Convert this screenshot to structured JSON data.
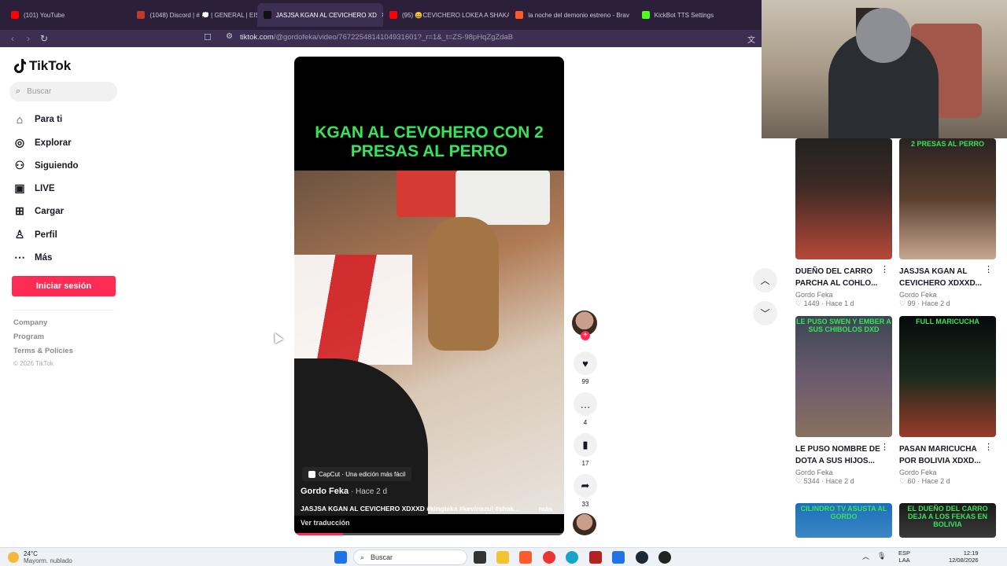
{
  "browser": {
    "tabs": [
      {
        "label": "(101) YouTube",
        "color": "#ff0000"
      },
      {
        "label": "(1048) Discord | # 💭 | GENERAL | EISUS",
        "color": "#c0392b"
      },
      {
        "label": "JASJSA KGAN AL CEVICHERO XD",
        "color": "#111111",
        "active": true
      },
      {
        "label": "(95) 😄CEVICHERO LOKEA A SHAKA",
        "color": "#ff0000"
      },
      {
        "label": "la noche del demonio estreno - Brav",
        "color": "#ff5a2b"
      },
      {
        "label": "KickBot TTS Settings",
        "color": "#53fc18"
      }
    ],
    "url_domain": "tiktok.com",
    "url_path": "/@gordofeka/video/7672254814104931601?_r=1&_t=ZS-98pHqZgZdaB"
  },
  "sidebar": {
    "logo": "TikTok",
    "search_placeholder": "Buscar",
    "items": [
      {
        "label": "Para ti",
        "icon": "home-icon"
      },
      {
        "label": "Explorar",
        "icon": "compass-icon"
      },
      {
        "label": "Siguiendo",
        "icon": "following-icon"
      },
      {
        "label": "LIVE",
        "icon": "live-icon"
      },
      {
        "label": "Cargar",
        "icon": "upload-icon"
      },
      {
        "label": "Perfil",
        "icon": "profile-icon"
      },
      {
        "label": "Más",
        "icon": "more-icon"
      }
    ],
    "login_label": "Iniciar sesión",
    "footer": [
      "Company",
      "Program",
      "Terms & Policies"
    ],
    "copyright": "© 2026 TikTok"
  },
  "video": {
    "overlay_title": "KGAN AL CEVOHERO CON 2 PRESAS AL PERRO",
    "capcut_label": "CapCut · Una edición más fácil",
    "author": "Gordo Feka",
    "time": " · Hace 2 d",
    "description": "JASJSA KGAN AL CEVICHERO XDXXD #kingteka #kevinazul #shak...",
    "more_label": "más",
    "translate_label": "Ver traducción",
    "progress": 0.18,
    "likes": "99",
    "comments": "4",
    "saves": "17",
    "shares": "33"
  },
  "recommended": [
    {
      "title": "DUEÑO DEL CARRO PARCHA AL COHLO...",
      "author": "Gordo Feka",
      "likes": "1449",
      "time": "Hace 1 d",
      "overlay": ""
    },
    {
      "title": "JASJSA KGAN AL CEVICHERO XDXXD...",
      "author": "Gordo Feka",
      "likes": "99",
      "time": "Hace 2 d",
      "overlay": "2 PRESAS AL PERRO"
    },
    {
      "title": "LE PUSO NOMBRE DE DOTA A SUS HIJOS...",
      "author": "Gordo Feka",
      "likes": "5344",
      "time": "Hace 2 d",
      "overlay": "LE PUSO SWEN Y EMBER A SUS CHIBOLOS DXD"
    },
    {
      "title": "PASAN MARICUCHA POR BOLIVIA XDXD...",
      "author": "Gordo Feka",
      "likes": "60",
      "time": "Hace 2 d",
      "overlay": "FULL MARICUCHA"
    },
    {
      "title": "",
      "author": "",
      "likes": "",
      "time": "",
      "overlay": "CILINDRO TV ASUSTA AL GORDO"
    },
    {
      "title": "",
      "author": "",
      "likes": "",
      "time": "",
      "overlay": "EL DUEÑO DEL CARRO DEJA A LOS FEKAS EN BOLIVIA"
    }
  ],
  "taskbar": {
    "weather_temp": "24°C",
    "weather_desc": "Mayorm. nublado",
    "search_label": "Buscar",
    "lang_top": "ESP",
    "lang_bottom": "LAA",
    "time": "12:19",
    "date": "12/08/2026"
  }
}
